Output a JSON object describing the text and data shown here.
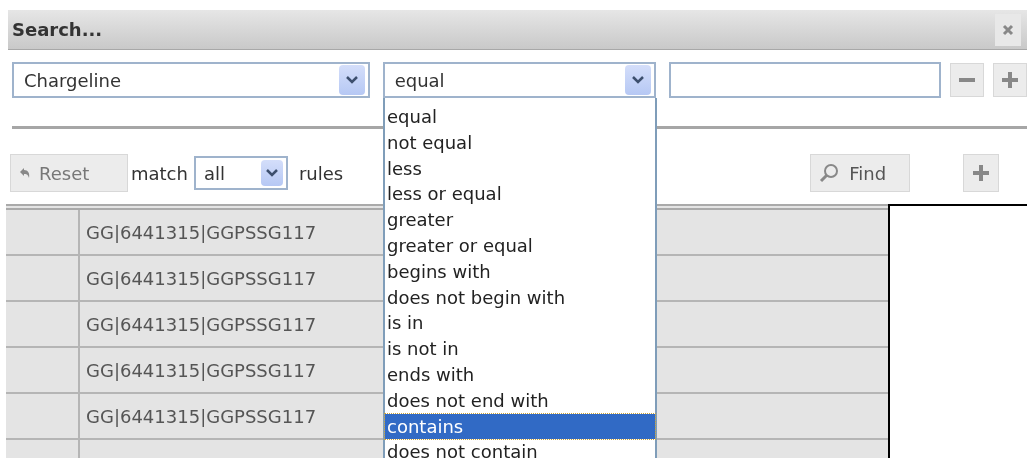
{
  "dialog": {
    "title": "Search..."
  },
  "rule": {
    "field": "Chargeline",
    "operator": "equal"
  },
  "operator_options": [
    {
      "label": "equal",
      "selected": false
    },
    {
      "label": "not equal",
      "selected": false
    },
    {
      "label": "less",
      "selected": false
    },
    {
      "label": "less or equal",
      "selected": false
    },
    {
      "label": "greater",
      "selected": false
    },
    {
      "label": "greater or equal",
      "selected": false
    },
    {
      "label": "begins with",
      "selected": false
    },
    {
      "label": "does not begin with",
      "selected": false
    },
    {
      "label": "is in",
      "selected": false
    },
    {
      "label": "is not in",
      "selected": false
    },
    {
      "label": "ends with",
      "selected": false
    },
    {
      "label": "does not end with",
      "selected": false
    },
    {
      "label": "contains",
      "selected": true
    },
    {
      "label": "does not contain",
      "selected": false
    }
  ],
  "toolbar": {
    "reset_button": "Reset",
    "match_label": "match",
    "match_select": "all",
    "rules_label": "rules",
    "find_button": "Find"
  },
  "grid": {
    "rows": [
      {
        "column_2": "GG|6441315|GGPSSG117"
      },
      {
        "column_2": "GG|6441315|GGPSSG117"
      },
      {
        "column_2": "GG|6441315|GGPSSG117"
      },
      {
        "column_2": "GG|6441315|GGPSSG117"
      },
      {
        "column_2": "GG|6441315|GGPSSG117"
      }
    ]
  }
}
